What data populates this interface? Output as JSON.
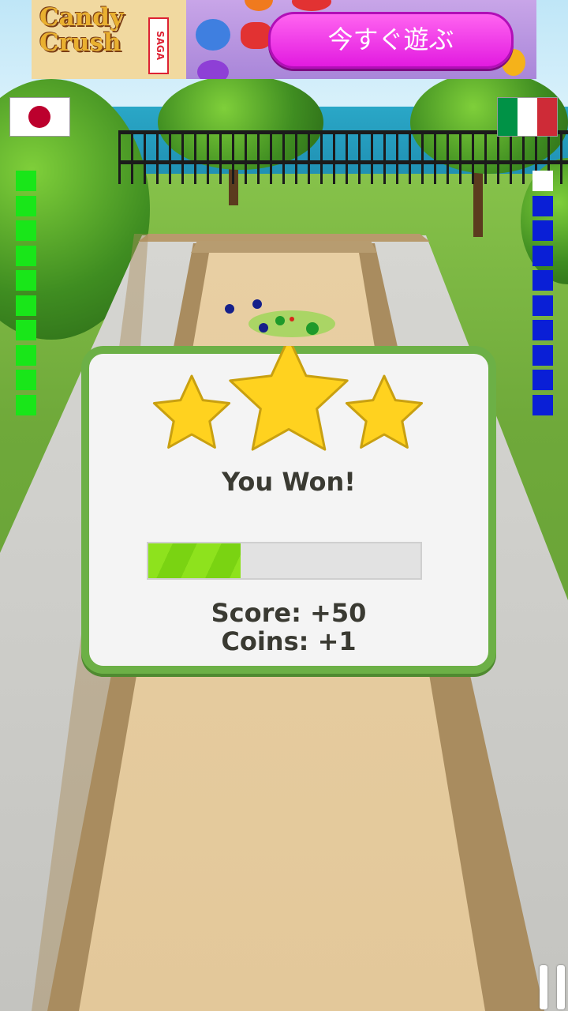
{
  "ad": {
    "logo_line1": "Candy",
    "logo_line2": "Crush",
    "logo_saga": "SAGA",
    "cta_label": "今すぐ遊ぶ"
  },
  "players": {
    "left": {
      "flag": "japan-flag",
      "meter_filled": 10,
      "meter_color": "#19e619"
    },
    "right": {
      "flag": "italy-flag",
      "meter_filled": 9,
      "meter_color": "#0a1fd6"
    }
  },
  "result": {
    "stars": 3,
    "title": "You Won!",
    "progress_fraction": 0.34,
    "score_text": "Score: +50",
    "coins_text": "Coins: +1"
  },
  "colors": {
    "panel_border": "#6cb046",
    "progress_fill": "#8ee21d",
    "star_fill": "#ffd21f",
    "ad_button": "#e21be0"
  },
  "icons": {
    "pause": "pause-icon",
    "star": "star-icon"
  }
}
